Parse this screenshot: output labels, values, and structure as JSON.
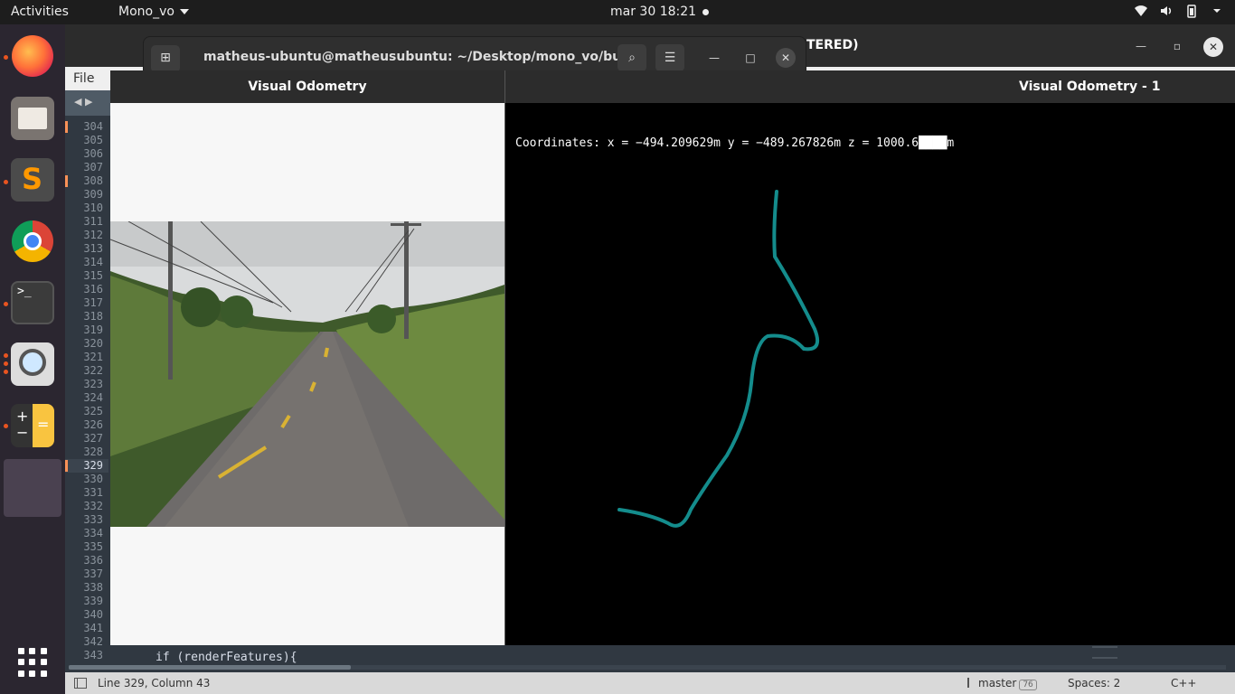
{
  "topbar": {
    "activities": "Activities",
    "app_menu": "Mono_vo",
    "clock": "mar 30  18:21"
  },
  "dock": {
    "items": [
      "firefox-icon",
      "files-icon",
      "sublime-text-icon",
      "chrome-icon",
      "terminal-icon",
      "search-tool-icon",
      "calculator-icon",
      "active-app-icon"
    ],
    "show_apps": "show-applications-icon"
  },
  "sublime": {
    "title_suffix": "TERED)",
    "menu_file": "File",
    "line_numbers": [
      "304",
      "305",
      "306",
      "307",
      "308",
      "309",
      "310",
      "311",
      "312",
      "313",
      "314",
      "315",
      "316",
      "317",
      "318",
      "319",
      "320",
      "321",
      "322",
      "323",
      "324",
      "325",
      "326",
      "327",
      "328",
      "329",
      "330",
      "331",
      "332",
      "333",
      "334",
      "335",
      "336",
      "337",
      "338",
      "339",
      "340",
      "341",
      "342",
      "343"
    ],
    "current_line": "329",
    "visible_code": "if (renderFeatures){",
    "status": {
      "position": "Line 329, Column 43",
      "branch": "master",
      "branch_badge": "76",
      "spaces": "Spaces: 2",
      "syntax": "C++"
    }
  },
  "terminal": {
    "title": "matheus-ubuntu@matheusubuntu: ~/Desktop/mono_vo/build"
  },
  "vo_window": {
    "title": "Visual Odometry"
  },
  "vo1_window": {
    "title": "Visual Odometry - 1",
    "coordinates": "Coordinates: x = −494.209629m y = −489.267826m z = 1000.6████m",
    "trajectory_color": "#148c8c"
  }
}
